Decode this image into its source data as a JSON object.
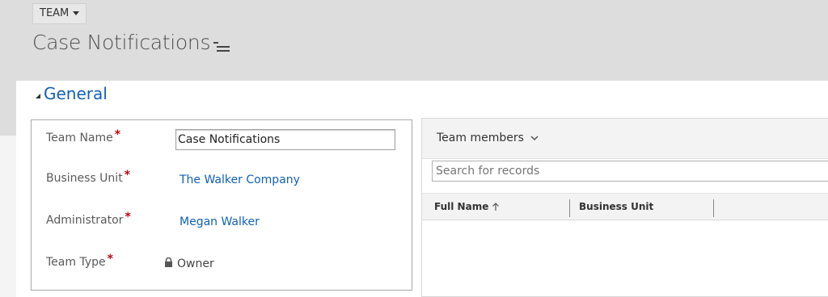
{
  "header": {
    "entity_label": "TEAM",
    "record_title": "Case Notifications"
  },
  "section": {
    "title": "General"
  },
  "form": {
    "team_name_label": "Team Name",
    "team_name_value": "Case Notifications",
    "business_unit_label": "Business Unit",
    "business_unit_value": "The Walker Company",
    "administrator_label": "Administrator",
    "administrator_value": "Megan Walker",
    "team_type_label": "Team Type",
    "team_type_value": "Owner",
    "required_marker": "*"
  },
  "subgrid": {
    "title": "Team members",
    "search_placeholder": "Search for records",
    "columns": [
      {
        "label": "Full Name",
        "sort": "ascending"
      },
      {
        "label": "Business Unit"
      }
    ]
  },
  "colors": {
    "link": "#1160b7",
    "required": "#c0000e",
    "header_bg": "#dddddd"
  }
}
